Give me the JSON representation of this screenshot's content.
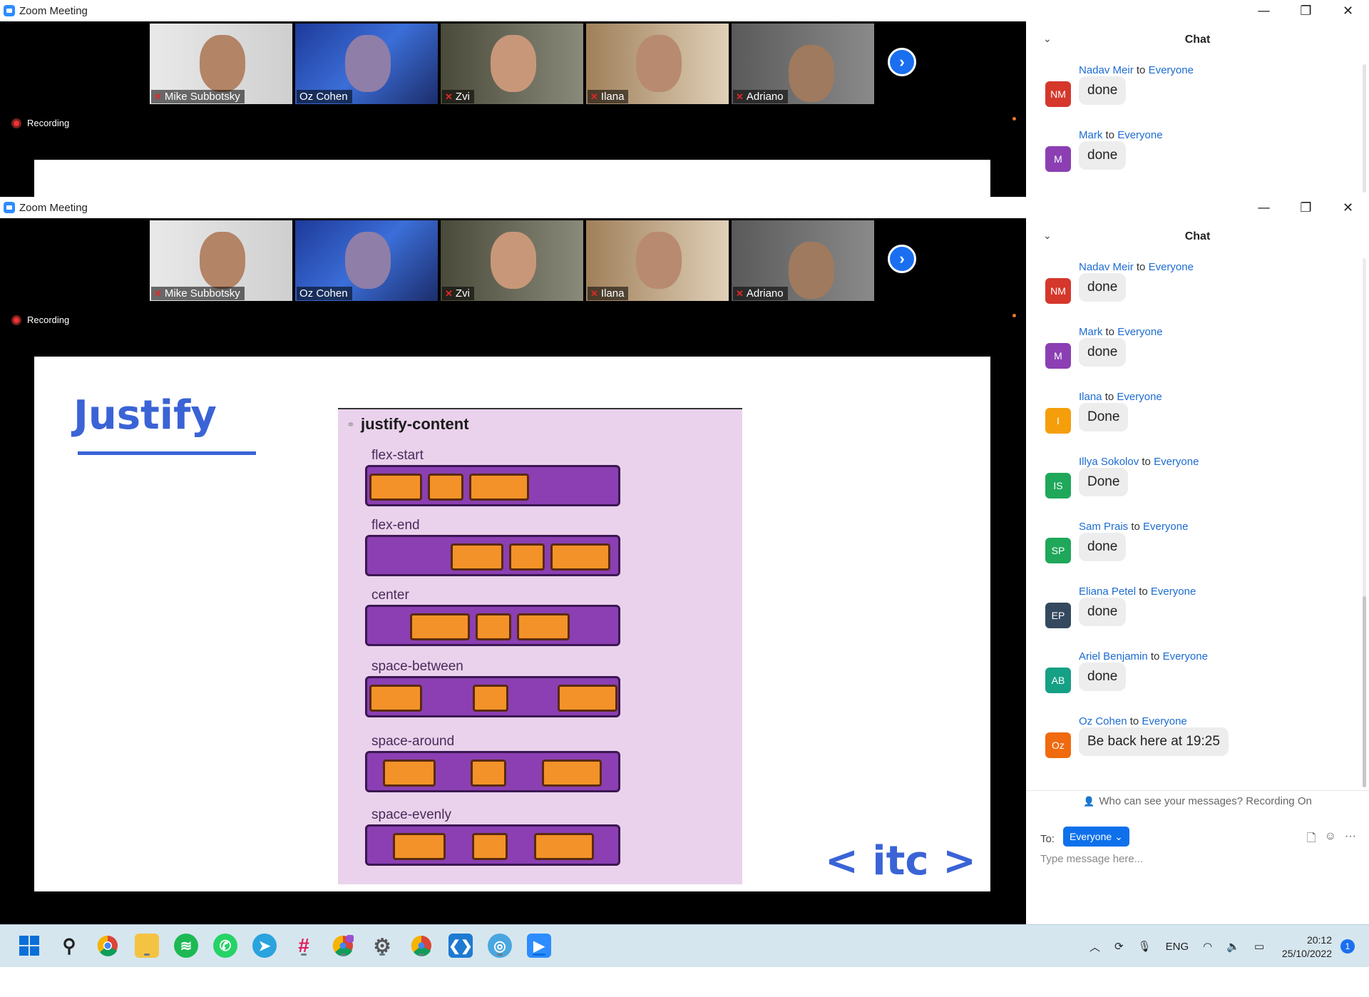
{
  "windows": [
    {
      "title": "Zoom Meeting",
      "recording_label": "Recording",
      "participants": [
        {
          "name": "Mike Subbotsky",
          "muted": true
        },
        {
          "name": "Oz Cohen",
          "muted": false,
          "active": true
        },
        {
          "name": "Zvi",
          "muted": true
        },
        {
          "name": "Ilana",
          "muted": true
        },
        {
          "name": "Adriano",
          "muted": true
        }
      ],
      "chat": {
        "header": "Chat",
        "messages": [
          {
            "sender": "Nadav Meir",
            "to_word": "to",
            "to": "Everyone",
            "initials": "NM",
            "color": "#d5372b",
            "text": "done"
          },
          {
            "sender": "Mark",
            "to_word": "to",
            "to": "Everyone",
            "initials": "M",
            "color": "#8b3fb3",
            "text": "done"
          }
        ]
      }
    },
    {
      "title": "Zoom Meeting",
      "recording_label": "Recording",
      "participants": [
        {
          "name": "Mike Subbotsky",
          "muted": true
        },
        {
          "name": "Oz Cohen",
          "muted": false,
          "active": true
        },
        {
          "name": "Zvi",
          "muted": true
        },
        {
          "name": "Ilana",
          "muted": true
        },
        {
          "name": "Adriano",
          "muted": true
        }
      ],
      "slide": {
        "title": "Justify",
        "diagram_title": "justify-content",
        "rows": [
          {
            "label": "flex-start"
          },
          {
            "label": "flex-end"
          },
          {
            "label": "center"
          },
          {
            "label": "space-between"
          },
          {
            "label": "space-around"
          },
          {
            "label": "space-evenly"
          }
        ],
        "logo": "< itc >"
      },
      "chat": {
        "header": "Chat",
        "messages": [
          {
            "sender": "Nadav Meir",
            "to_word": "to",
            "to": "Everyone",
            "initials": "NM",
            "color": "#d5372b",
            "text": "done"
          },
          {
            "sender": "Mark",
            "to_word": "to",
            "to": "Everyone",
            "initials": "M",
            "color": "#8b3fb3",
            "text": "done"
          },
          {
            "sender": "Ilana",
            "to_word": "to",
            "to": "Everyone",
            "initials": "I",
            "color": "#f59e0b",
            "text": "Done"
          },
          {
            "sender": "Illya Sokolov",
            "to_word": "to",
            "to": "Everyone",
            "initials": "IS",
            "color": "#1fa85a",
            "text": "Done"
          },
          {
            "sender": "Sam Prais",
            "to_word": "to",
            "to": "Everyone",
            "initials": "SP",
            "color": "#1fa85a",
            "text": "done"
          },
          {
            "sender": "Eliana Petel",
            "to_word": "to",
            "to": "Everyone",
            "initials": "EP",
            "color": "#34495e",
            "text": "done"
          },
          {
            "sender": "Ariel Benjamin",
            "to_word": "to",
            "to": "Everyone",
            "initials": "AB",
            "color": "#16a085",
            "text": "done"
          },
          {
            "sender": "Oz Cohen",
            "to_word": "to",
            "to": "Everyone",
            "initials": "Oz",
            "color": "#f06a0f",
            "text": "Be back here at 19:25"
          }
        ],
        "privacy_text": "Who can see your messages? Recording On",
        "to_label": "To:",
        "to_value": "Everyone",
        "input_placeholder": "Type message here..."
      }
    }
  ],
  "taskbar": {
    "apps": [
      "start",
      "search",
      "chrome",
      "file-explorer",
      "spotify",
      "whatsapp",
      "telegram",
      "slack",
      "chrome-profile-m",
      "settings",
      "chrome-2",
      "vscode",
      "maps",
      "zoom"
    ],
    "language": "ENG",
    "time": "20:12",
    "date": "25/10/2022",
    "notification_count": "1"
  },
  "colors": {
    "accent": "#2d8cff",
    "slide_blue": "#3a63d6",
    "bar_purple": "#8b3fb3",
    "box_orange": "#f39228"
  }
}
